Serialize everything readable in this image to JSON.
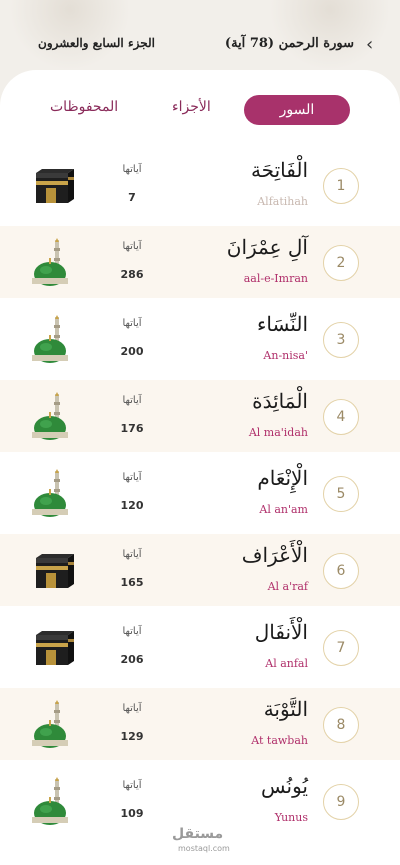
{
  "header": {
    "surah_title": "سورة الرحمن (78 آية)",
    "juz_title": "الجزء السابع والعشرون"
  },
  "tabs": [
    {
      "label": "السور",
      "active": true
    },
    {
      "label": "الأجزاء",
      "active": false
    },
    {
      "label": "المحفوظات",
      "active": false
    }
  ],
  "ayat_label": "آياتها",
  "surahs": [
    {
      "number": "1",
      "arabic": "الْفَاتِحَة",
      "latin": "Alfatihah",
      "ayat": "7",
      "icon": "kaaba-icon"
    },
    {
      "number": "2",
      "arabic": "آلِ عِمْرَانَ",
      "latin": "aal-e-Imran",
      "ayat": "286",
      "icon": "mosque-dome-icon"
    },
    {
      "number": "3",
      "arabic": "النِّسَاء",
      "latin": "An-nisa'",
      "ayat": "200",
      "icon": "mosque-dome-icon"
    },
    {
      "number": "4",
      "arabic": "الْمَائِدَة",
      "latin": "Al ma'idah",
      "ayat": "176",
      "icon": "mosque-dome-icon"
    },
    {
      "number": "5",
      "arabic": "الْإِنْعَام",
      "latin": "Al an'am",
      "ayat": "120",
      "icon": "mosque-dome-icon"
    },
    {
      "number": "6",
      "arabic": "الْأَعْرَاف",
      "latin": "Al a'raf",
      "ayat": "165",
      "icon": "kaaba-icon"
    },
    {
      "number": "7",
      "arabic": "الْأَنفَال",
      "latin": "Al anfal",
      "ayat": "206",
      "icon": "kaaba-icon"
    },
    {
      "number": "8",
      "arabic": "التَّوْبَة",
      "latin": "At tawbah",
      "ayat": "129",
      "icon": "mosque-dome-icon"
    },
    {
      "number": "9",
      "arabic": "يُونُس",
      "latin": "Yunus",
      "ayat": "109",
      "icon": "mosque-dome-icon"
    }
  ],
  "watermark": {
    "text": "مستقل",
    "sub": "mostaql.com"
  },
  "colors": {
    "accent": "#a8326b",
    "circle_border": "#e3d2a8"
  }
}
